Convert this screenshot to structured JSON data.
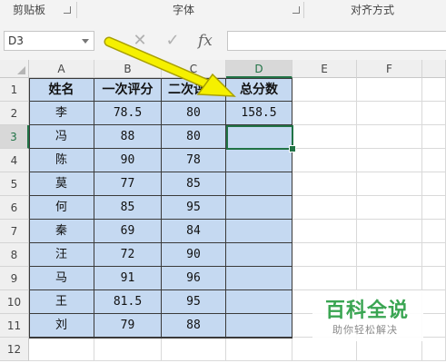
{
  "ribbon": {
    "groups": [
      {
        "label": "剪贴板"
      },
      {
        "label": "字体"
      },
      {
        "label": "对齐方式"
      }
    ]
  },
  "formula_bar": {
    "name_box": "D3",
    "cancel_glyph": "✕",
    "enter_glyph": "✓",
    "fx_label": "fx",
    "formula_value": ""
  },
  "sheet": {
    "columns": [
      "A",
      "B",
      "C",
      "D",
      "E",
      "F"
    ],
    "active_column": "D",
    "rows": [
      "1",
      "2",
      "3",
      "4",
      "5",
      "6",
      "7",
      "8",
      "9",
      "10",
      "11",
      "12"
    ],
    "active_row": "3",
    "headers": [
      "姓名",
      "一次评分",
      "二次评分",
      "总分数"
    ],
    "data": [
      {
        "name": "李",
        "score1": "78.5",
        "score2": "80",
        "total": "158.5"
      },
      {
        "name": "冯",
        "score1": "88",
        "score2": "80",
        "total": ""
      },
      {
        "name": "陈",
        "score1": "90",
        "score2": "78",
        "total": ""
      },
      {
        "name": "莫",
        "score1": "77",
        "score2": "85",
        "total": ""
      },
      {
        "name": "何",
        "score1": "85",
        "score2": "95",
        "total": ""
      },
      {
        "name": "秦",
        "score1": "69",
        "score2": "84",
        "total": ""
      },
      {
        "name": "汪",
        "score1": "72",
        "score2": "90",
        "total": ""
      },
      {
        "name": "马",
        "score1": "91",
        "score2": "96",
        "total": ""
      },
      {
        "name": "王",
        "score1": "81.5",
        "score2": "95",
        "total": ""
      },
      {
        "name": "刘",
        "score1": "79",
        "score2": "88",
        "total": ""
      }
    ],
    "selected_cell": "D3"
  },
  "colors": {
    "table_fill": "#c5d9f1",
    "selection": "#217346",
    "arrow": "#f5f000",
    "watermark": "#3aa552"
  },
  "watermark": {
    "title": "百科全说",
    "subtitle": "助你轻松解决"
  }
}
